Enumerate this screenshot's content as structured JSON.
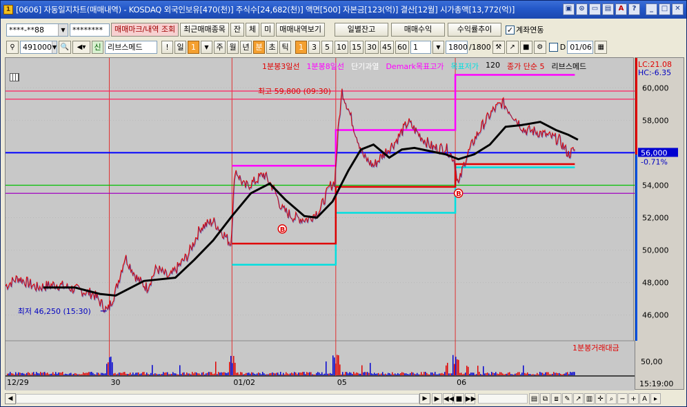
{
  "window": {
    "title": "[0606] 자동일지차트(매매내역) - KOSDAQ 외국인보유[470(천)] 주식수[24,682(천)] 액면[500] 자본금[123(억)] 결산[12월] 시가총액[13,772(억)]",
    "icon_label": "1"
  },
  "toolbar1": {
    "account": "****-**88",
    "password": "********",
    "trade_mark_button": "매매마크/내역 조회",
    "recent_trades_button": "최근매매종목",
    "tab_jan": "잔",
    "tab_che": "체",
    "tab_mi": "미",
    "trade_history_button": "매매내역보기",
    "daily_balance_button": "일별잔고",
    "trade_profit_button": "매매수익",
    "profit_trend_button": "수익률추이",
    "account_link_label": "계좌연동",
    "account_link_checked": true
  },
  "toolbar2": {
    "stock_code": "491000",
    "stock_badge": "신",
    "stock_name": "리브스메드",
    "period_day": "일",
    "period_week": "주",
    "period_month": "월",
    "period_year": "년",
    "period_min": "분",
    "period_sec": "초",
    "period_tick": "틱",
    "interval_1": "1",
    "interval_3": "3",
    "interval_5": "5",
    "interval_10": "10",
    "interval_15": "15",
    "interval_30": "30",
    "interval_45": "45",
    "interval_60": "60",
    "interval_value": "1",
    "count_value": "1800",
    "count_total": "/1800",
    "date_value": "01/06"
  },
  "legend": {
    "items": [
      "1분봉3일선",
      "1분봉8일선",
      "단기과열",
      "Demark목표고가",
      "목표저가",
      "120",
      "종가 단순 5",
      "리브스메드"
    ],
    "colors": [
      "#e00000",
      "#ff00ff",
      "#ffffff",
      "#ff00ff",
      "#00e0e0",
      "#000000",
      "#e00000",
      "#000000"
    ]
  },
  "annotations": {
    "high_label": "최고 59,800 (09:30)",
    "low_label": "최저 46,250 (15:30)",
    "buy_marker": "B"
  },
  "right_panel": {
    "lc": "LC:21.08",
    "hc": "HC:-6.35",
    "current_price": "56,000",
    "change_pct": "-0.71%",
    "volume_axis_label": "50,00",
    "time_label": "15:19:00"
  },
  "volume": {
    "legend": "1분봉거래대금"
  },
  "chart_data": {
    "type": "line",
    "title": "",
    "y_ticks": [
      46000,
      48000,
      50000,
      52000,
      54000,
      56000,
      58000,
      60000
    ],
    "y_tick_labels": [
      "46,000",
      "48,000",
      "50,000",
      "52,000",
      "54,000",
      "56,000",
      "58,000",
      "60,000"
    ],
    "ylim": [
      44500,
      61500
    ],
    "x_labels": [
      "12/29",
      "30",
      "01/02",
      "05",
      "06"
    ],
    "day_starts": [
      0,
      0.165,
      0.36,
      0.525,
      0.715
    ],
    "price_anchors": [
      [
        0.0,
        47800
      ],
      [
        0.02,
        48300
      ],
      [
        0.05,
        47700
      ],
      [
        0.08,
        47900
      ],
      [
        0.11,
        47600
      ],
      [
        0.14,
        47300
      ],
      [
        0.162,
        46250
      ],
      [
        0.175,
        47500
      ],
      [
        0.19,
        49600
      ],
      [
        0.21,
        48200
      ],
      [
        0.225,
        47700
      ],
      [
        0.24,
        48900
      ],
      [
        0.26,
        48300
      ],
      [
        0.29,
        49700
      ],
      [
        0.31,
        51400
      ],
      [
        0.33,
        51800
      ],
      [
        0.345,
        51100
      ],
      [
        0.358,
        50400
      ],
      [
        0.365,
        55000
      ],
      [
        0.38,
        53900
      ],
      [
        0.395,
        54200
      ],
      [
        0.41,
        54700
      ],
      [
        0.425,
        53900
      ],
      [
        0.44,
        52500
      ],
      [
        0.46,
        52000
      ],
      [
        0.48,
        51900
      ],
      [
        0.5,
        52500
      ],
      [
        0.515,
        53900
      ],
      [
        0.523,
        54200
      ],
      [
        0.53,
        58000
      ],
      [
        0.535,
        59800
      ],
      [
        0.545,
        58700
      ],
      [
        0.555,
        57400
      ],
      [
        0.57,
        55700
      ],
      [
        0.585,
        55200
      ],
      [
        0.6,
        55900
      ],
      [
        0.62,
        56700
      ],
      [
        0.64,
        57900
      ],
      [
        0.66,
        57000
      ],
      [
        0.68,
        56300
      ],
      [
        0.7,
        56300
      ],
      [
        0.713,
        55600
      ],
      [
        0.72,
        54000
      ],
      [
        0.73,
        55500
      ],
      [
        0.745,
        56800
      ],
      [
        0.76,
        57800
      ],
      [
        0.775,
        58600
      ],
      [
        0.79,
        59100
      ],
      [
        0.805,
        58400
      ],
      [
        0.825,
        57400
      ],
      [
        0.845,
        57300
      ],
      [
        0.865,
        57000
      ],
      [
        0.88,
        56800
      ],
      [
        0.895,
        55900
      ],
      [
        0.905,
        56200
      ]
    ],
    "ma_anchors": [
      [
        0.06,
        47700
      ],
      [
        0.11,
        47700
      ],
      [
        0.15,
        47300
      ],
      [
        0.175,
        47200
      ],
      [
        0.22,
        48100
      ],
      [
        0.27,
        48300
      ],
      [
        0.3,
        49400
      ],
      [
        0.33,
        50600
      ],
      [
        0.36,
        52100
      ],
      [
        0.39,
        53500
      ],
      [
        0.42,
        54100
      ],
      [
        0.445,
        53100
      ],
      [
        0.475,
        52100
      ],
      [
        0.495,
        52000
      ],
      [
        0.52,
        53000
      ],
      [
        0.545,
        54900
      ],
      [
        0.565,
        56200
      ],
      [
        0.585,
        56500
      ],
      [
        0.61,
        55700
      ],
      [
        0.63,
        56200
      ],
      [
        0.65,
        56300
      ],
      [
        0.675,
        56100
      ],
      [
        0.7,
        55900
      ],
      [
        0.72,
        55600
      ],
      [
        0.745,
        55900
      ],
      [
        0.77,
        56500
      ],
      [
        0.795,
        57600
      ],
      [
        0.82,
        57700
      ],
      [
        0.85,
        57900
      ],
      [
        0.875,
        57400
      ],
      [
        0.895,
        57100
      ],
      [
        0.91,
        56800
      ]
    ],
    "horizontal_lines": [
      {
        "name": "high-line",
        "y": 59800,
        "color": "#ff2060"
      },
      {
        "name": "prev-high-line",
        "y": 59300,
        "color": "#ff2060"
      },
      {
        "name": "current-price-line",
        "y": 56000,
        "color": "#0000ff"
      },
      {
        "name": "green-line",
        "y": 54000,
        "color": "#00c000"
      },
      {
        "name": "purple-line",
        "y": 53500,
        "color": "#a000c0"
      }
    ],
    "demark_high": [
      [
        0.36,
        0.525,
        55200
      ],
      [
        0.525,
        0.715,
        57400
      ],
      [
        0.715,
        0.905,
        60800
      ]
    ],
    "demark_low": [
      [
        0.36,
        0.525,
        49100
      ],
      [
        0.525,
        0.715,
        52300
      ],
      [
        0.715,
        0.905,
        55100
      ]
    ],
    "red_level": [
      [
        0.36,
        0.525,
        50400
      ],
      [
        0.525,
        0.715,
        53900
      ],
      [
        0.715,
        0.905,
        55300
      ]
    ],
    "buy_points": [
      [
        0.44,
        51900
      ],
      [
        0.72,
        54100
      ]
    ]
  }
}
